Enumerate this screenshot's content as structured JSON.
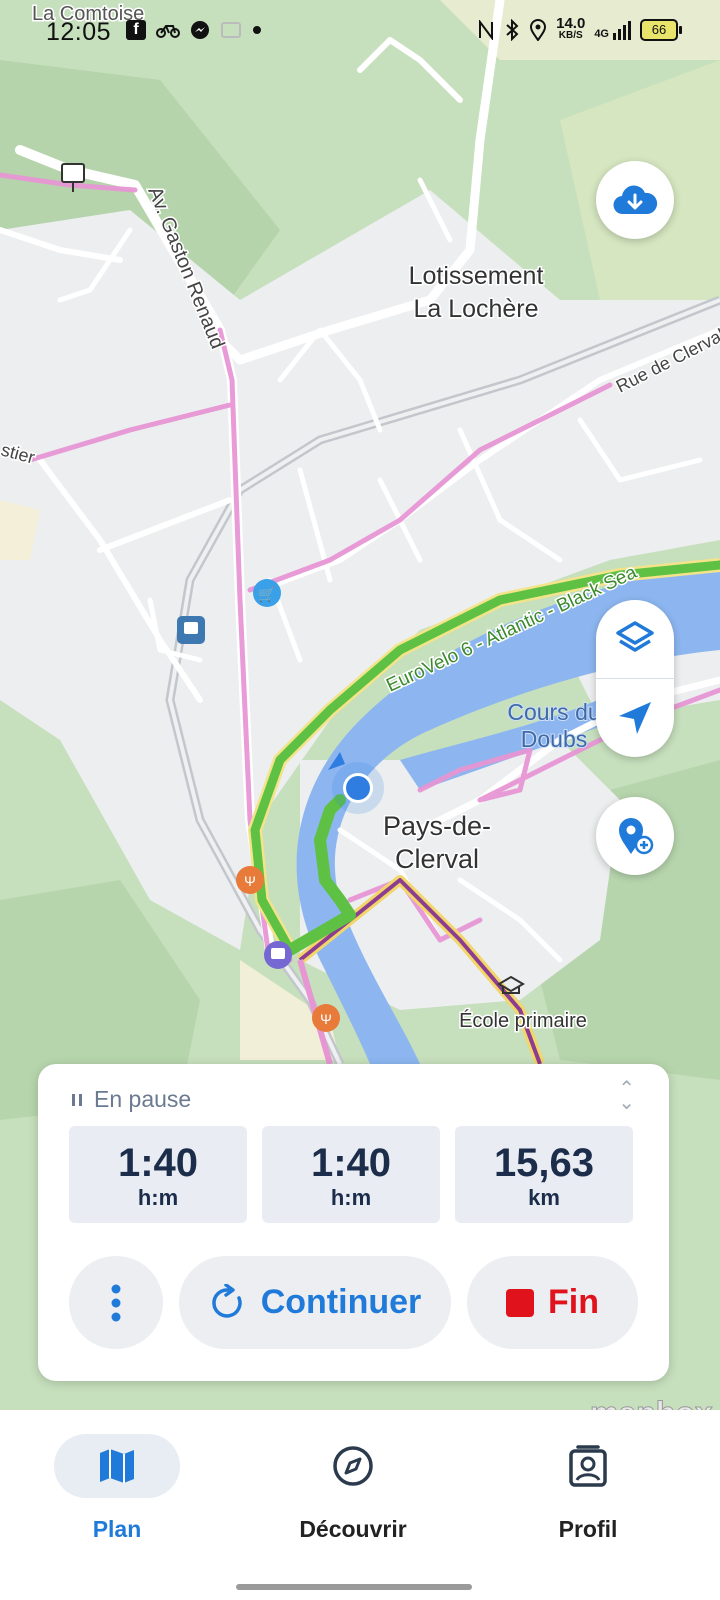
{
  "status_bar": {
    "time": "12:05",
    "net_speed_value": "14.0",
    "net_speed_unit": "KB/S",
    "signal": "4G",
    "battery": "66",
    "left_icons": [
      "facebook-icon",
      "bike-icon",
      "messenger-icon",
      "photo-icon",
      "dot-icon"
    ],
    "right_icons": [
      "nfc-icon",
      "bluetooth-icon",
      "location-icon",
      "signal-icon",
      "battery-icon"
    ]
  },
  "map": {
    "labels": {
      "la_comtoise": "La Comtoise",
      "gaston_renaud": "Av. Gaston Renaud",
      "lotissement_l1": "Lotissement",
      "lotissement_l2": "La Lochère",
      "rue_clerval": "Rue de Clerval",
      "stier": "stier",
      "eurovelo": "EuroVelo 6 - Atlantic - Black Sea",
      "cours_l1": "Cours du",
      "cours_l2": "Doubs",
      "pays_l1": "Pays-de-",
      "pays_l2": "Clerval",
      "ecole": "École primaire",
      "mapbox": "mapbox"
    },
    "colors": {
      "land": "#c6dfbd",
      "urban": "#eef0f2",
      "river": "#8db6f0",
      "route": "#5ec143",
      "cycleway": "#e796d4",
      "road": "#ffffff"
    }
  },
  "fabs": {
    "download": "cloud-download-icon",
    "layers": "layers-icon",
    "locate": "navigation-arrow-icon",
    "add_place": "add-location-icon"
  },
  "panel": {
    "status": "En pause",
    "stats": [
      {
        "value": "1:40",
        "unit": "h:m"
      },
      {
        "value": "1:40",
        "unit": "h:m"
      },
      {
        "value": "15,63",
        "unit": "km"
      }
    ],
    "continue_label": "Continuer",
    "end_label": "Fin"
  },
  "nav": {
    "items": [
      {
        "label": "Plan",
        "icon": "map-icon",
        "active": true
      },
      {
        "label": "Découvrir",
        "icon": "compass-icon",
        "active": false
      },
      {
        "label": "Profil",
        "icon": "profile-icon",
        "active": false
      }
    ]
  }
}
